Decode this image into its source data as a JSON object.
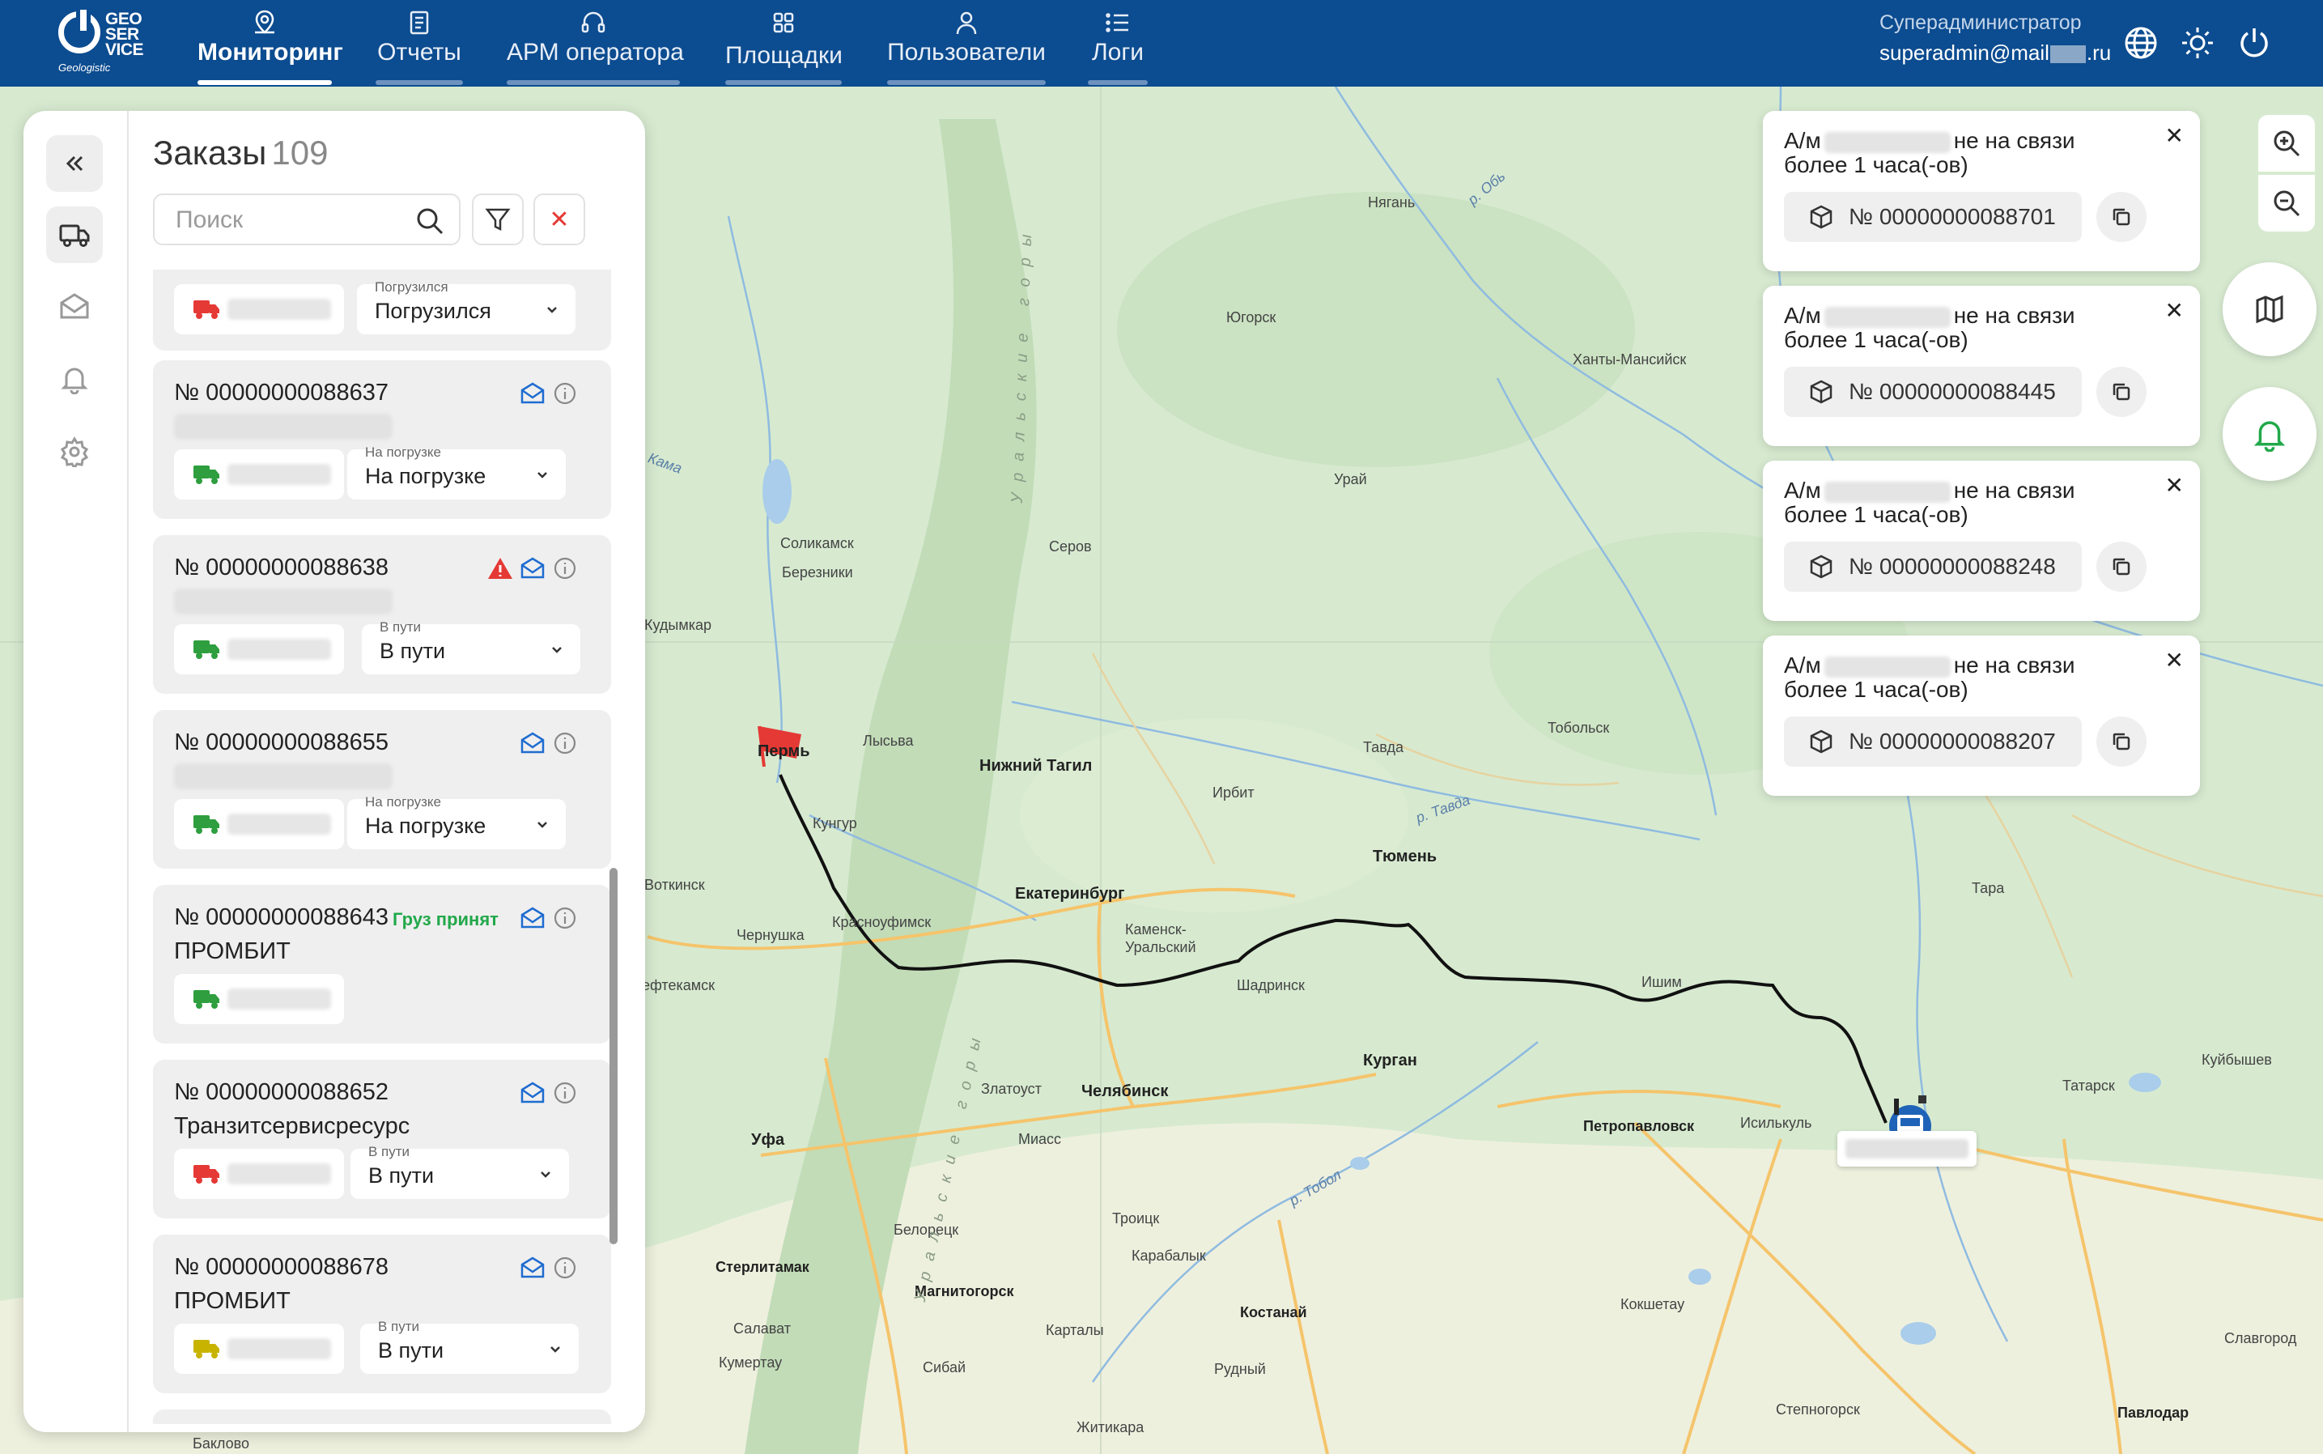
{
  "brand": {
    "logo_text": "GEO SER VICE",
    "logo_sub": "Geologistic"
  },
  "nav": [
    {
      "label": "Мониторинг",
      "icon": "map-pin-icon",
      "active": true
    },
    {
      "label": "Отчеты",
      "icon": "clipboard-icon",
      "active": false
    },
    {
      "label": "АРМ оператора",
      "icon": "headset-icon",
      "active": false
    },
    {
      "label": "Площадки",
      "icon": "grid-icon",
      "active": false
    },
    {
      "label": "Пользователи",
      "icon": "user-icon",
      "active": false
    },
    {
      "label": "Логи",
      "icon": "list-icon",
      "active": false
    }
  ],
  "user": {
    "role": "Суперадминистратор",
    "email_prefix": "superadmin@mail",
    "email_suffix": ".ru"
  },
  "colors": {
    "header": "#0c4c90",
    "truck_red": "#e53935",
    "truck_green": "#2e9e3e",
    "truck_yellow": "#c8b400",
    "accept_green": "#22a84a",
    "route": "#111111"
  },
  "orders": {
    "title": "Заказы",
    "count": "109",
    "search_placeholder": "Поиск",
    "items": [
      {
        "number": "",
        "client": "",
        "truck": "red",
        "status_caption": "Погрузился",
        "status": "Погрузился"
      },
      {
        "number": "№ 00000000088637",
        "client": "",
        "truck": "green",
        "status_caption": "На погрузке",
        "status": "На погрузке"
      },
      {
        "number": "№ 00000000088638",
        "client": "",
        "truck": "green",
        "status_caption": "В пути",
        "status": "В пути",
        "warning": true
      },
      {
        "number": "№ 00000000088655",
        "client": "",
        "truck": "green",
        "status_caption": "На погрузке",
        "status": "На погрузке"
      },
      {
        "number": "№ 00000000088643",
        "client": "ПРОМБИТ",
        "truck": "green",
        "badge": "Груз принят"
      },
      {
        "number": "№ 00000000088652",
        "client": "Транзитсервисресурс",
        "truck": "red",
        "status_caption": "В пути",
        "status": "В пути"
      },
      {
        "number": "№ 00000000088678",
        "client": "ПРОМБИТ",
        "truck": "yellow",
        "status_caption": "В пути",
        "status": "В пути"
      }
    ]
  },
  "notifications": [
    {
      "prefix": "А/м",
      "suffix": "не на связи",
      "line2": "более 1 часа(-ов)",
      "order": "№ 00000000088701"
    },
    {
      "prefix": "А/м",
      "suffix": "не на связи",
      "line2": "более 1 часа(-ов)",
      "order": "№ 00000000088445"
    },
    {
      "prefix": "А/м",
      "suffix": "не на связи",
      "line2": "более 1 часа(-ов)",
      "order": "№ 00000000088248"
    },
    {
      "prefix": "А/м",
      "suffix": "не на связи",
      "line2": "более 1 часа(-ов)",
      "order": "№ 00000000088207"
    }
  ],
  "map": {
    "cities": [
      {
        "name": "Нягань"
      },
      {
        "name": "Югорск"
      },
      {
        "name": "Ханты-Мансийск"
      },
      {
        "name": "Урай"
      },
      {
        "name": "Соликамск"
      },
      {
        "name": "Березники"
      },
      {
        "name": "Серов"
      },
      {
        "name": "Кудымкар"
      },
      {
        "name": "Пермь"
      },
      {
        "name": "Лысьва"
      },
      {
        "name": "Нижний Тагил"
      },
      {
        "name": "Тавда"
      },
      {
        "name": "Тобольск"
      },
      {
        "name": "Ирбит"
      },
      {
        "name": "Кунгур"
      },
      {
        "name": "Тюмень"
      },
      {
        "name": "Воткинск"
      },
      {
        "name": "Екатеринбург"
      },
      {
        "name": "Чернушка"
      },
      {
        "name": "Красноуфимск"
      },
      {
        "name": "Каменск-Уральский"
      },
      {
        "name": "Ишим"
      },
      {
        "name": "Тара"
      },
      {
        "name": "Шадринск"
      },
      {
        "name": "Нефтекамск"
      },
      {
        "name": "Курган"
      },
      {
        "name": "Куйбышев"
      },
      {
        "name": "Татарск"
      },
      {
        "name": "Златоуст"
      },
      {
        "name": "Челябинск"
      },
      {
        "name": "Уфа"
      },
      {
        "name": "Миасс"
      },
      {
        "name": "Петропавловск"
      },
      {
        "name": "Исилькуль"
      },
      {
        "name": "Троицк"
      },
      {
        "name": "Белорецк"
      },
      {
        "name": "Стерлитамак"
      },
      {
        "name": "Карабалык"
      },
      {
        "name": "Магнитогорск"
      },
      {
        "name": "Костанай"
      },
      {
        "name": "Кокшетау"
      },
      {
        "name": "Салават"
      },
      {
        "name": "Карталы"
      },
      {
        "name": "Кумертау"
      },
      {
        "name": "Сибай"
      },
      {
        "name": "Рудный"
      },
      {
        "name": "Славгород"
      },
      {
        "name": "Степногорск"
      },
      {
        "name": "Павлодар"
      },
      {
        "name": "Житикара"
      },
      {
        "name": "Баклово"
      }
    ],
    "water_labels": [
      "р. Обь",
      "Кама",
      "р. Тавда",
      "р. Тобол",
      "Уральские горы",
      "Уральские горы"
    ]
  }
}
